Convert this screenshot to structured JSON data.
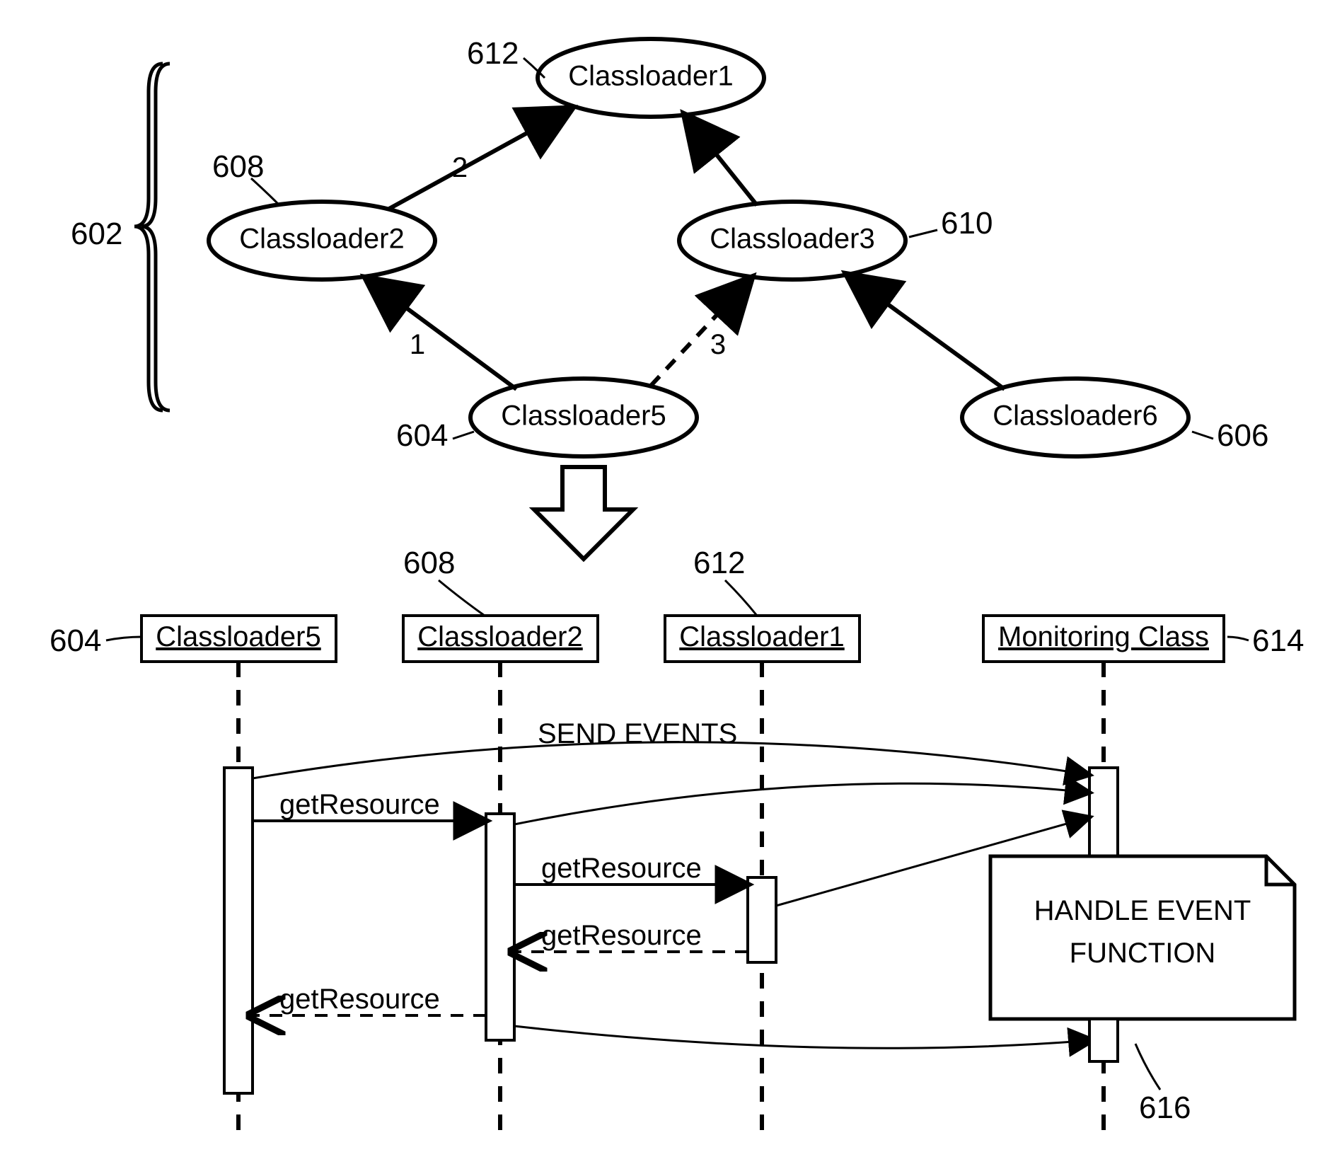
{
  "graph": {
    "nodes": {
      "cl1": "Classloader1",
      "cl2": "Classloader2",
      "cl3": "Classloader3",
      "cl5": "Classloader5",
      "cl6": "Classloader6"
    },
    "edge_labels": {
      "e1": "1",
      "e2": "2",
      "e3": "3"
    },
    "refs": {
      "group": "602",
      "cl1": "612",
      "cl2": "608",
      "cl3": "610",
      "cl5": "604",
      "cl6": "606"
    }
  },
  "seq": {
    "lifelines": {
      "l1": "Classloader5",
      "l2": "Classloader2",
      "l3": "Classloader1",
      "l4": "Monitoring Class"
    },
    "lifeline_refs": {
      "l1": "604",
      "l2": "608",
      "l3": "612",
      "l4": "614"
    },
    "msg": {
      "send_events": "SEND EVENTS",
      "m1": "getResource",
      "m2": "getResource",
      "m3": "getResource",
      "m4": "getResource"
    },
    "note": {
      "line1": "HANDLE EVENT",
      "line2": "FUNCTION",
      "ref": "616"
    }
  }
}
